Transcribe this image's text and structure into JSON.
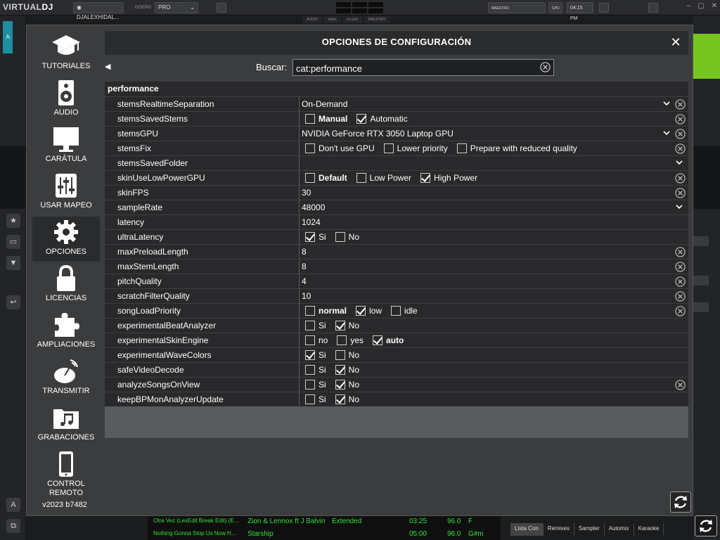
{
  "app": {
    "logo_a": "VIRTUAL",
    "logo_b": "DJ",
    "account": "DJALEXHIDAL...",
    "layout_label": "DISEÑO",
    "layout_value": "PRO",
    "master_label": "MAESTRO",
    "cpu_label": "CPU",
    "clock": "04:15 PM",
    "deck_label": "A",
    "subtabs": [
      "AUDIO",
      "Video",
      "Scratch",
      "MAESTRO"
    ]
  },
  "dialog": {
    "title": "OPCIONES DE CONFIGURACIÓN",
    "close_glyph": "✕",
    "back_glyph": "◀",
    "version": "v2023 b7482",
    "search": {
      "label": "Buscar:",
      "value": "cat:performance"
    },
    "sidebar": [
      {
        "label": "TUTORIALES",
        "icon": "graduation-cap-icon"
      },
      {
        "label": "AUDIO",
        "icon": "speaker-icon"
      },
      {
        "label": "CARÁTULA",
        "icon": "monitor-icon"
      },
      {
        "label": "USAR MAPEO",
        "icon": "sliders-icon"
      },
      {
        "label": "OPCIONES",
        "icon": "gear-icon",
        "active": true
      },
      {
        "label": "LICENCIAS",
        "icon": "lock-icon"
      },
      {
        "label": "AMPLIACIONES",
        "icon": "puzzle-icon"
      },
      {
        "label": "TRANSMITIR",
        "icon": "broadcast-icon"
      },
      {
        "label": "GRABACIONES",
        "icon": "music-folder-icon"
      },
      {
        "label": "CONTROL REMOTO",
        "icon": "phone-icon"
      }
    ],
    "category": "performance",
    "settings": [
      {
        "name": "stemsRealtimeSeparation",
        "value": "On-Demand",
        "dropdown": true,
        "reset": true
      },
      {
        "name": "stemsSavedStems",
        "options": [
          {
            "label": "Manual",
            "checked": false,
            "bold": true
          },
          {
            "label": "Automatic",
            "checked": true
          }
        ],
        "reset": true
      },
      {
        "name": "stemsGPU",
        "value": "NVIDIA GeForce RTX 3050 Laptop GPU",
        "dropdown": true,
        "reset": true
      },
      {
        "name": "stemsFix",
        "options": [
          {
            "label": "Don't use GPU",
            "checked": false
          },
          {
            "label": "Lower priority",
            "checked": false
          },
          {
            "label": "Prepare with reduced quality",
            "checked": false
          }
        ],
        "reset": true
      },
      {
        "name": "stemsSavedFolder",
        "value": "",
        "dropdown": true,
        "dropdown_far": true,
        "reset": false
      },
      {
        "name": "skinUseLowPowerGPU",
        "options": [
          {
            "label": "Default",
            "checked": false,
            "bold": true
          },
          {
            "label": "Low Power",
            "checked": false
          },
          {
            "label": "High Power",
            "checked": true
          }
        ],
        "reset": true
      },
      {
        "name": "skinFPS",
        "value": "30",
        "reset": true
      },
      {
        "name": "sampleRate",
        "value": "48000",
        "dropdown": true,
        "dropdown_far": true,
        "reset": false
      },
      {
        "name": "latency",
        "value": "1024",
        "reset": false
      },
      {
        "name": "ultraLatency",
        "options": [
          {
            "label": "Si",
            "checked": true
          },
          {
            "label": "No",
            "checked": false
          }
        ],
        "reset": false
      },
      {
        "name": "maxPreloadLength",
        "value": "8",
        "reset": true
      },
      {
        "name": "maxStemLength",
        "value": "8",
        "reset": true
      },
      {
        "name": "pitchQuality",
        "value": "4",
        "reset": true
      },
      {
        "name": "scratchFilterQuality",
        "value": "10",
        "reset": true
      },
      {
        "name": "songLoadPriority",
        "options": [
          {
            "label": "normal",
            "checked": false,
            "bold": true
          },
          {
            "label": "low",
            "checked": true
          },
          {
            "label": "idle",
            "checked": false
          }
        ],
        "reset": true
      },
      {
        "name": "experimentalBeatAnalyzer",
        "options": [
          {
            "label": "Si",
            "checked": false
          },
          {
            "label": "No",
            "checked": true
          }
        ],
        "reset": false
      },
      {
        "name": "experimentalSkinEngine",
        "options": [
          {
            "label": "no",
            "checked": false
          },
          {
            "label": "yes",
            "checked": false
          },
          {
            "label": "auto",
            "checked": true,
            "bold": true
          }
        ],
        "reset": false
      },
      {
        "name": "experimentalWaveColors",
        "options": [
          {
            "label": "Si",
            "checked": true
          },
          {
            "label": "No",
            "checked": false
          }
        ],
        "reset": false
      },
      {
        "name": "safeVideoDecode",
        "options": [
          {
            "label": "Si",
            "checked": false
          },
          {
            "label": "No",
            "checked": true
          }
        ],
        "reset": false
      },
      {
        "name": "analyzeSongsOnView",
        "options": [
          {
            "label": "Si",
            "checked": false
          },
          {
            "label": "No",
            "checked": true
          }
        ],
        "reset": true
      },
      {
        "name": "keepBPMonAnalyzerUpdate",
        "options": [
          {
            "label": "Si",
            "checked": false
          },
          {
            "label": "No",
            "checked": true
          }
        ],
        "reset": false
      }
    ]
  },
  "browser": {
    "tracks": [
      {
        "title": "Otra Vez (LexEdit Break Edit) (E...",
        "artist": "Zion & Lennox ft J Balvin",
        "remix": "Extended",
        "length": "03:25",
        "bpm": "96.0",
        "key": "F"
      },
      {
        "title": "Nothing Gonna Stop Us Now H...",
        "artist": "Starship",
        "remix": "",
        "length": "05:00",
        "bpm": "96.0",
        "key": "G#m"
      }
    ],
    "tabs": [
      "Lista Con",
      "Remixes",
      "Sampler",
      "Automix",
      "Karaoke"
    ]
  },
  "colors": {
    "accent_teal": "#1c8fa3",
    "accent_green": "#77c51f",
    "track_text": "#35e035",
    "dialog_bg": "#3b3c3e",
    "row_bg": "#29292b"
  }
}
